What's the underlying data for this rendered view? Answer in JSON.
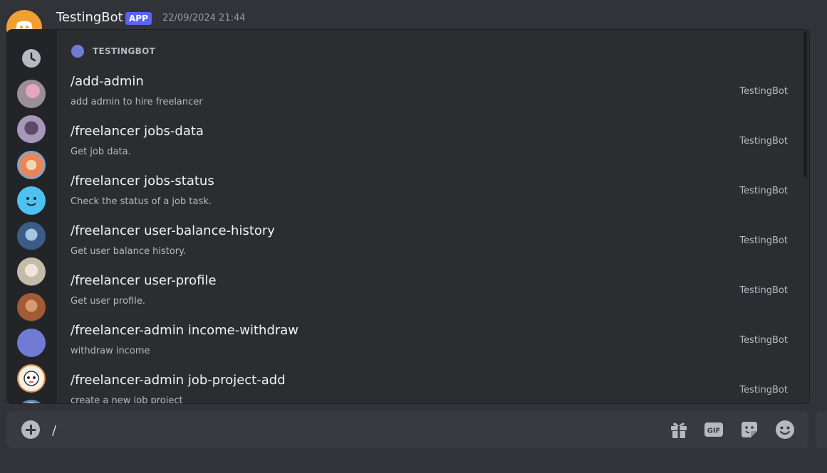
{
  "message": {
    "author": "TestingBot",
    "badge": "APP",
    "timestamp": "22/09/2024 21:44"
  },
  "popup": {
    "section_title": "TESTINGBOT",
    "commands": [
      {
        "name": "/add-admin",
        "description": "add admin to hire freelancer",
        "app": "TestingBot"
      },
      {
        "name": "/freelancer jobs-data",
        "description": "Get job data.",
        "app": "TestingBot"
      },
      {
        "name": "/freelancer jobs-status",
        "description": "Check the status of a job task.",
        "app": "TestingBot"
      },
      {
        "name": "/freelancer user-balance-history",
        "description": "Get user balance history.",
        "app": "TestingBot"
      },
      {
        "name": "/freelancer user-profile",
        "description": "Get user profile.",
        "app": "TestingBot"
      },
      {
        "name": "/freelancer-admin income-withdraw",
        "description": "withdraw income",
        "app": "TestingBot"
      },
      {
        "name": "/freelancer-admin job-project-add",
        "description": "create a new job project",
        "app": "TestingBot"
      }
    ],
    "rail_icons": [
      "clock-icon",
      "app-avatar",
      "app-avatar",
      "app-avatar",
      "app-avatar",
      "app-avatar",
      "app-avatar",
      "app-avatar",
      "app-avatar",
      "app-avatar"
    ]
  },
  "composer": {
    "value": "/",
    "tools": [
      "gift-icon",
      "gif-icon",
      "sticker-icon",
      "emoji-icon"
    ],
    "gif_label": "GIF"
  },
  "colors": {
    "background": "#313338",
    "popup": "#2b2d31",
    "rail": "#232428",
    "accent": "#5865f2"
  }
}
